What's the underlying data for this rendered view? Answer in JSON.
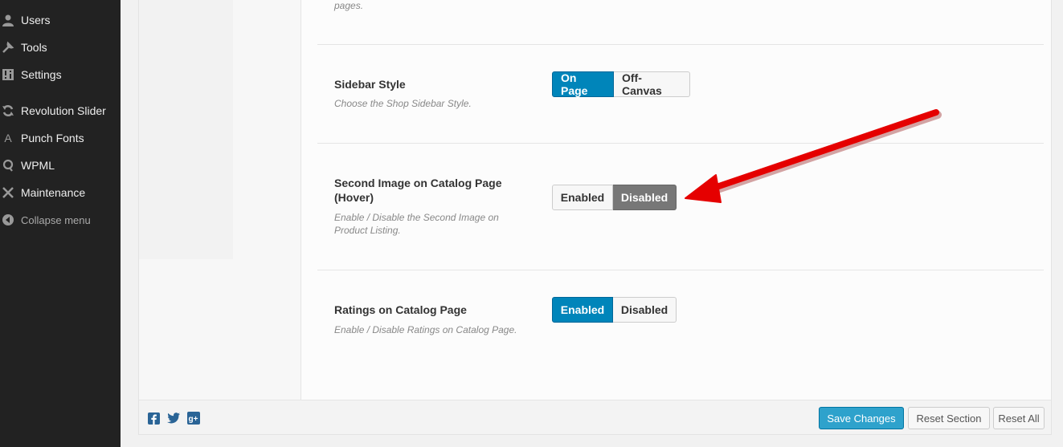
{
  "sidebar": {
    "items": [
      {
        "label": "Users",
        "icon": "user-icon"
      },
      {
        "label": "Tools",
        "icon": "wrench-icon"
      },
      {
        "label": "Settings",
        "icon": "settings-icon"
      },
      {
        "label": "Revolution Slider",
        "icon": "refresh-icon"
      },
      {
        "label": "Punch Fonts",
        "icon": "font-icon"
      },
      {
        "label": "WPML",
        "icon": "wpml-icon"
      },
      {
        "label": "Maintenance",
        "icon": "maintenance-icon"
      }
    ],
    "collapse_label": "Collapse menu"
  },
  "content": {
    "top_fragment": "pages.",
    "options": [
      {
        "title": "Sidebar Style",
        "desc": "Choose the Shop Sidebar Style.",
        "buttons": [
          "On Page",
          "Off-Canvas"
        ],
        "selected": "On Page"
      },
      {
        "title": "Second Image on Catalog Page (Hover)",
        "desc": "Enable / Disable the Second Image on Product Listing.",
        "buttons": [
          "Enabled",
          "Disabled"
        ],
        "selected": "Disabled"
      },
      {
        "title": "Ratings on Catalog Page",
        "desc": "Enable / Disable Ratings on Catalog Page.",
        "buttons": [
          "Enabled",
          "Disabled"
        ],
        "selected": "Enabled"
      }
    ]
  },
  "footer": {
    "social": [
      "facebook-icon",
      "twitter-icon",
      "google-plus-icon"
    ],
    "save_label": "Save Changes",
    "reset_section_label": "Reset Section",
    "reset_all_label": "Reset All"
  },
  "colors": {
    "accent_blue": "#0085ba",
    "selected_gray": "#777777",
    "annotation_red": "#e00000",
    "admin_bg": "#222222"
  }
}
